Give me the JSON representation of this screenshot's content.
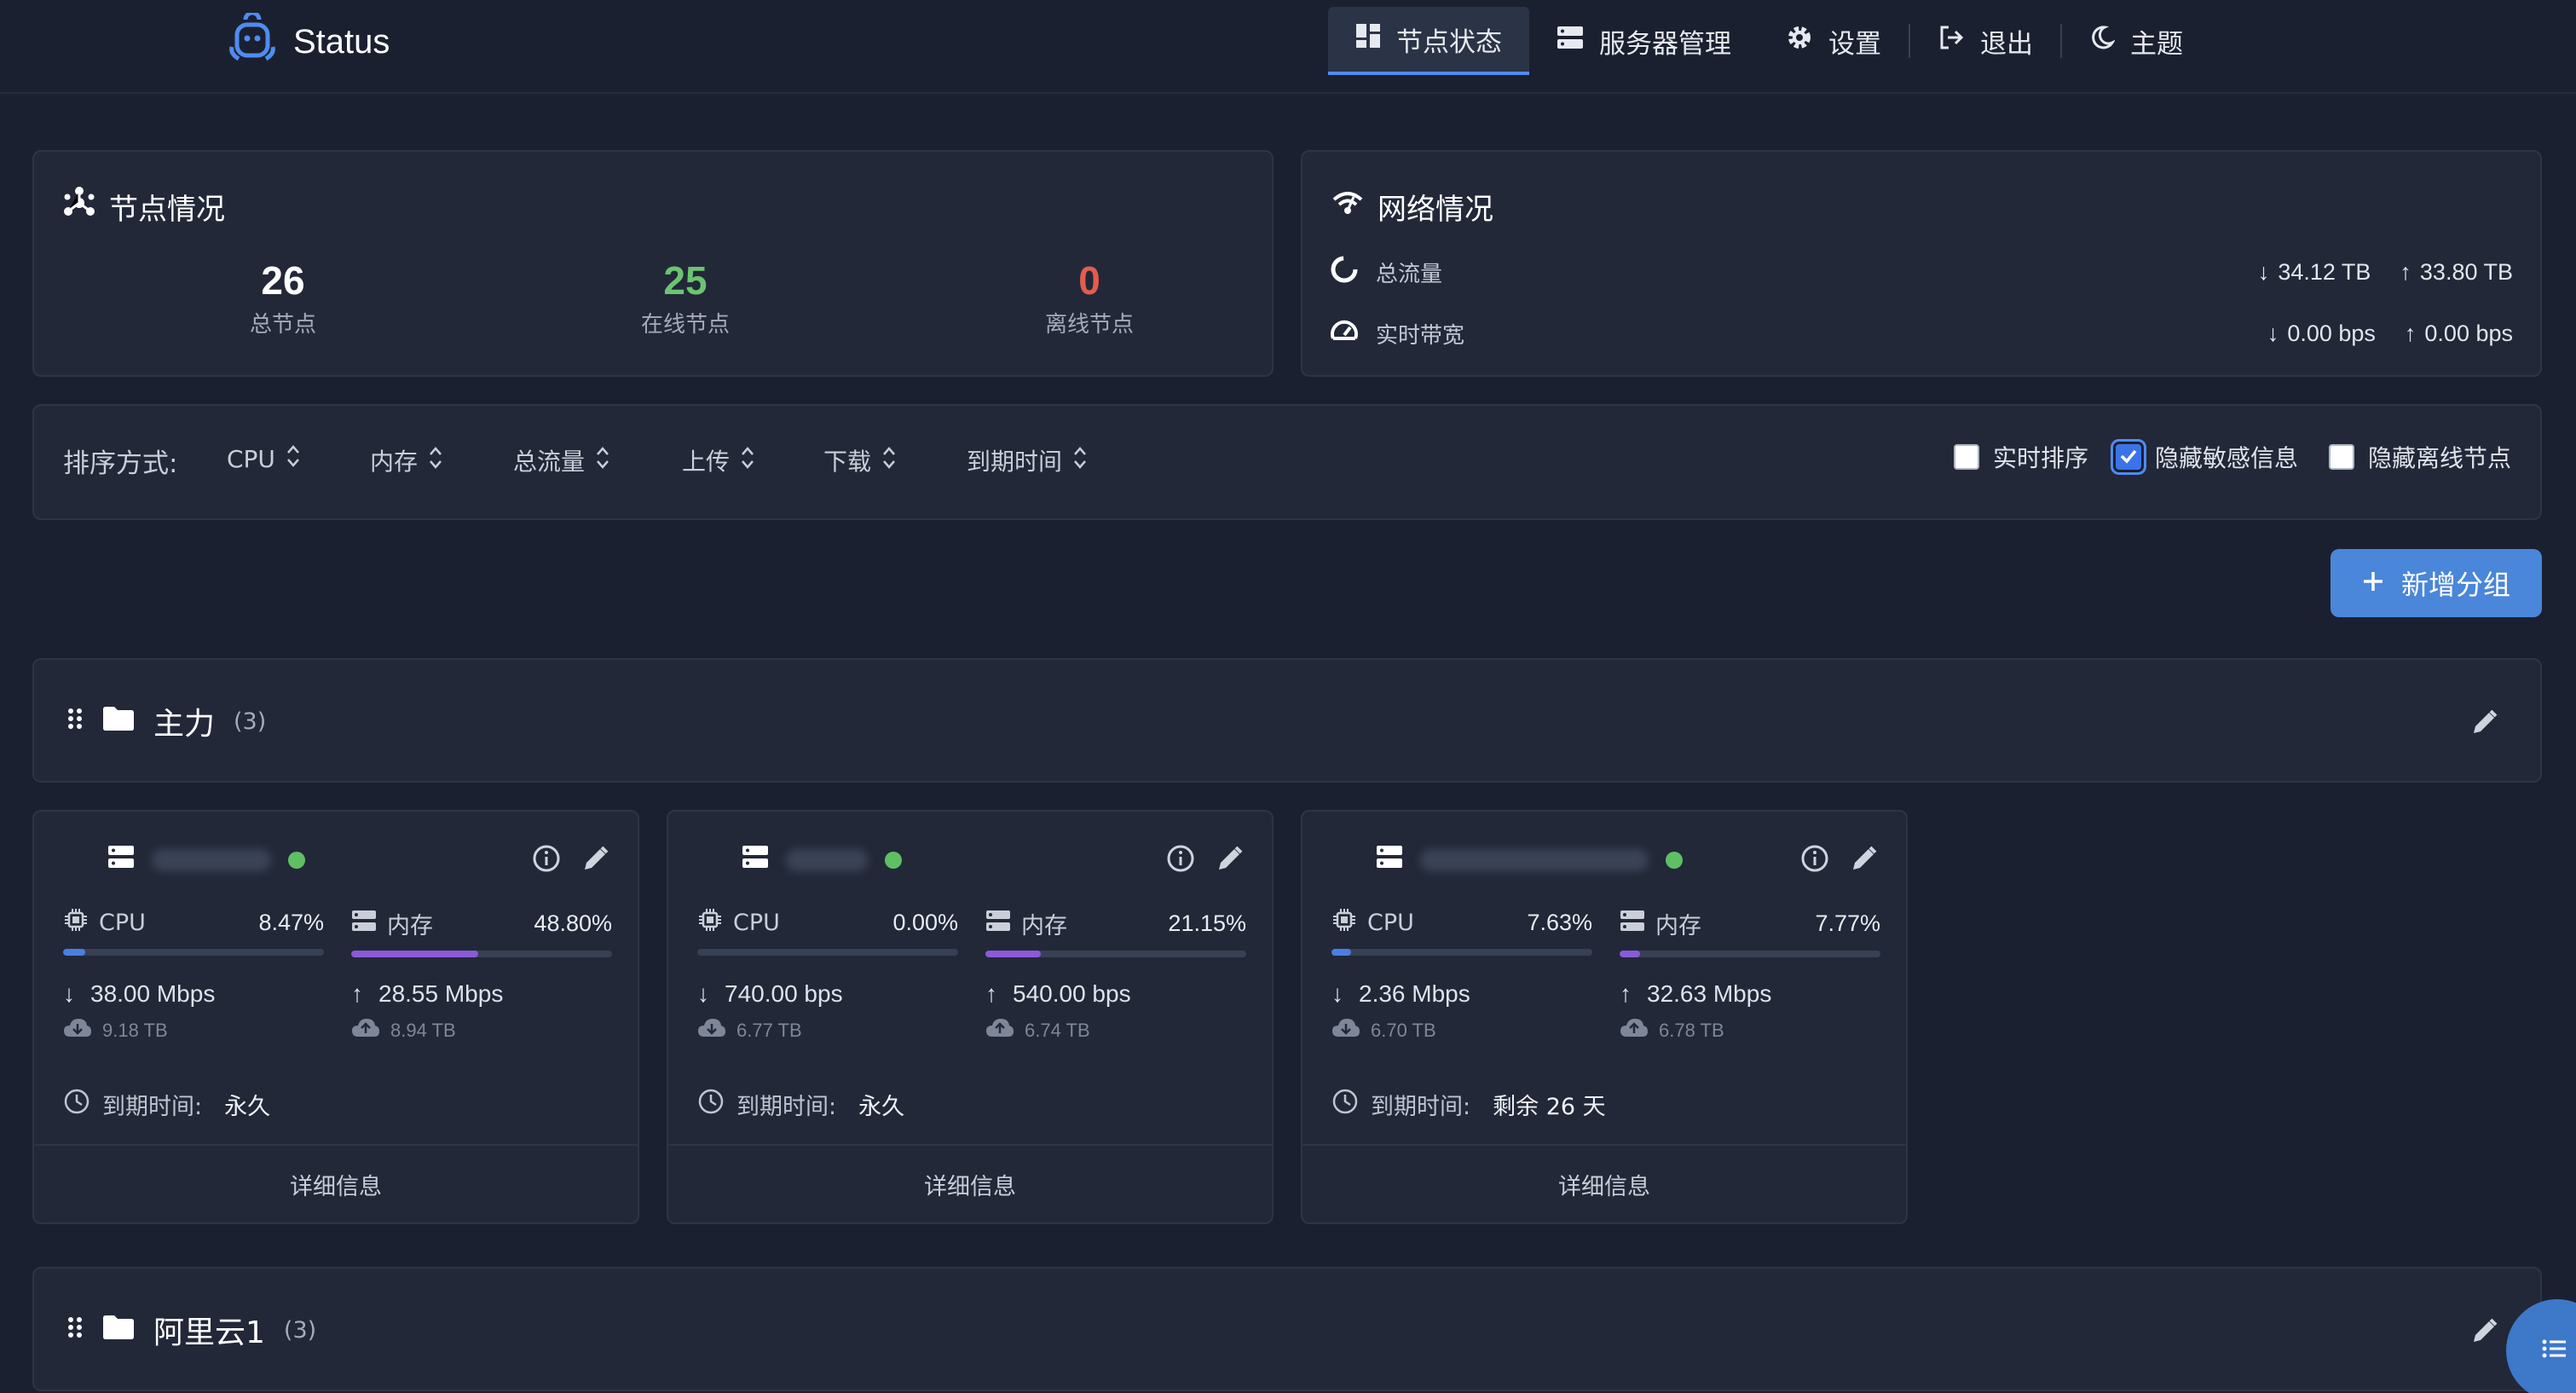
{
  "header": {
    "brand": "Status",
    "nav": [
      {
        "label": "节点状态",
        "icon": "dashboard-icon",
        "active": true
      },
      {
        "label": "服务器管理",
        "icon": "server-icon",
        "active": false
      },
      {
        "label": "设置",
        "icon": "gear-icon",
        "active": false
      },
      {
        "label": "退出",
        "icon": "logout-icon",
        "active": false
      },
      {
        "label": "主题",
        "icon": "moon-icon",
        "active": false
      }
    ]
  },
  "nodes": {
    "title": "节点情况",
    "total": {
      "value": "26",
      "label": "总节点"
    },
    "online": {
      "value": "25",
      "label": "在线节点"
    },
    "offline": {
      "value": "0",
      "label": "离线节点"
    }
  },
  "network": {
    "title": "网络情况",
    "traffic": {
      "label": "总流量",
      "down": "34.12 TB",
      "up": "33.80 TB"
    },
    "bandwidth": {
      "label": "实时带宽",
      "down": "0.00 bps",
      "up": "0.00 bps"
    }
  },
  "sort": {
    "label": "排序方式:",
    "options": [
      "CPU",
      "内存",
      "总流量",
      "上传",
      "下载",
      "到期时间"
    ],
    "realtime": {
      "label": "实时排序",
      "checked": false
    },
    "hide_sensitive": {
      "label": "隐藏敏感信息",
      "checked": true
    },
    "hide_offline": {
      "label": "隐藏离线节点",
      "checked": false
    }
  },
  "add_group": "新增分组",
  "groups": [
    {
      "name": "主力",
      "count": "(3)"
    },
    {
      "name": "阿里云1",
      "count": "(3)"
    }
  ],
  "servers": [
    {
      "cpu_label": "CPU",
      "cpu": "8.47%",
      "cpu_pct": 8.47,
      "mem_label": "内存",
      "mem": "48.80%",
      "mem_pct": 48.8,
      "down": "38.00 Mbps",
      "up": "28.55 Mbps",
      "down_total": "9.18 TB",
      "up_total": "8.94 TB",
      "expire_label": "到期时间:",
      "expire": "永久",
      "detail": "详细信息"
    },
    {
      "cpu_label": "CPU",
      "cpu": "0.00%",
      "cpu_pct": 0.0,
      "mem_label": "内存",
      "mem": "21.15%",
      "mem_pct": 21.15,
      "down": "740.00 bps",
      "up": "540.00 bps",
      "down_total": "6.77 TB",
      "up_total": "6.74 TB",
      "expire_label": "到期时间:",
      "expire": "永久",
      "detail": "详细信息"
    },
    {
      "cpu_label": "CPU",
      "cpu": "7.63%",
      "cpu_pct": 7.63,
      "mem_label": "内存",
      "mem": "7.77%",
      "mem_pct": 7.77,
      "down": "2.36 Mbps",
      "up": "32.63 Mbps",
      "down_total": "6.70 TB",
      "up_total": "6.78 TB",
      "expire_label": "到期时间:",
      "expire": "剩余 26 天",
      "detail": "详细信息"
    }
  ],
  "colors": {
    "accent": "#4f8cf0",
    "online": "#6cc36f",
    "offline": "#e35d4f",
    "cpu_bar": "#4a7fe0",
    "mem_bar": "#8a5ad8"
  }
}
